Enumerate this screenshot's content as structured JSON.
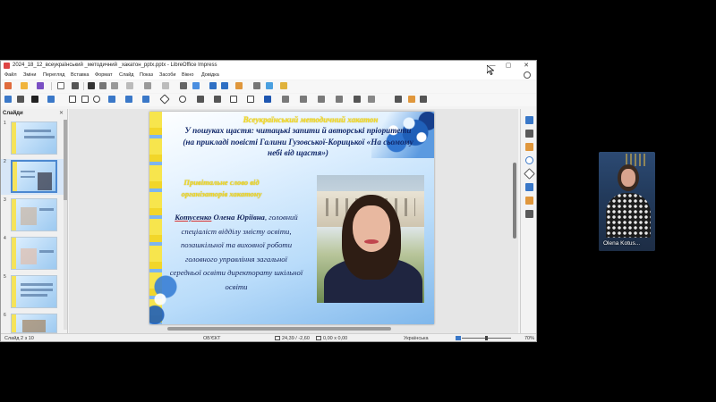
{
  "window": {
    "title": "2024_18_12_всеукраїнський _методичний _хакатон_pptx.pptx - LibreOffice Impress",
    "minimize": "—",
    "maximize": "▢",
    "close": "✕"
  },
  "menu": [
    "Файл",
    "Зміни",
    "Перегляд",
    "Вставка",
    "Формат",
    "Слайд",
    "Показ",
    "Засоби",
    "Вікно",
    "Довідка"
  ],
  "slides_panel": {
    "title": "Слайди",
    "close": "✕",
    "thumb_numbers": [
      "1",
      "2",
      "3",
      "4",
      "5",
      "6"
    ]
  },
  "slide": {
    "conference_title": "Всеукраїнський методичний хакатон",
    "topic": "У пошуках щастя: читацькі запити й авторські пріоритети (на прикладі повісті Галини Гузовської-Корицької «На сьомому небі від щастя»)",
    "section_label": "Привітальне слово від організаторів хакатону",
    "speaker_surname": "Котусенко",
    "speaker_name": "Олена Юріївна",
    "speaker_role": "головний спеціаліст відділу змісту освіти, позашкільної та виховної роботи головного управління загальної середньої освіти директорату шкільної освіти"
  },
  "statusbar": {
    "slide_info": "Слайд 2 з 10",
    "layout": "ОБ'ЄКТ",
    "position": "24,39 / -2,60",
    "size": "0,00 x 0,00",
    "language": "Українська",
    "zoom": "70%"
  },
  "video": {
    "participant_name": "Olena Kotus..."
  },
  "colors": {
    "slide_title_yellow": "#f2dc2c",
    "slide_text_navy": "#13235a",
    "accent_blue": "#4c88d0"
  }
}
